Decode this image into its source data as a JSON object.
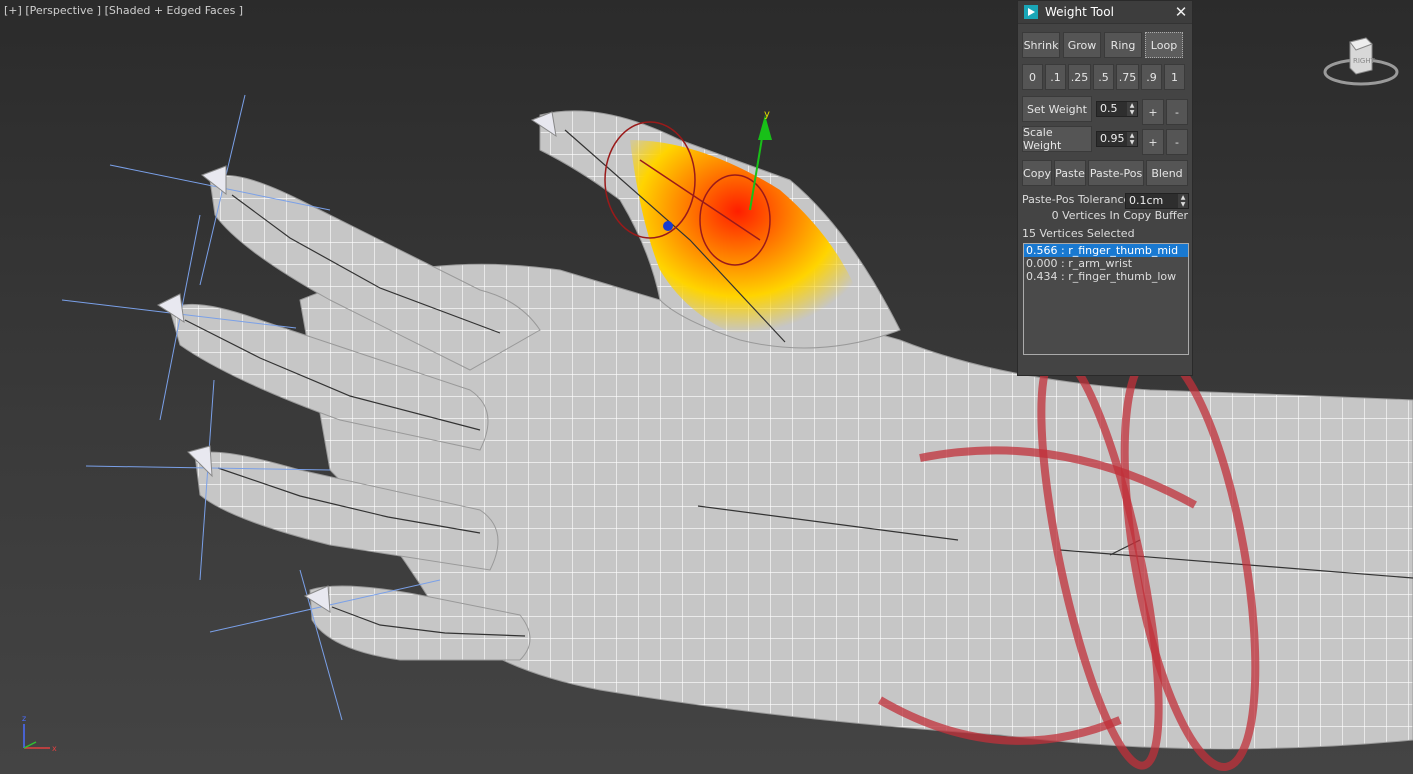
{
  "viewport": {
    "label_parts": [
      "[+]",
      "[Perspective ]",
      "[Shaded + Edged Faces ]"
    ],
    "gizmo_axis_label": "y",
    "viewcube_label": "RIGHT",
    "tripod_labels": {
      "z": "z",
      "x": "x"
    }
  },
  "weight_tool": {
    "title": "Weight Tool",
    "close_glyph": "✕",
    "select_buttons": [
      "Shrink",
      "Grow",
      "Ring",
      "Loop"
    ],
    "preset_weights": [
      "0",
      ".1",
      ".25",
      ".5",
      ".75",
      ".9",
      "1"
    ],
    "set_weight": {
      "label": "Set Weight",
      "value": "0.5",
      "plus": "+",
      "minus": "-"
    },
    "scale_weight": {
      "label": "Scale Weight",
      "value": "0.95",
      "plus": "+",
      "minus": "-"
    },
    "clipboard_buttons": [
      "Copy",
      "Paste",
      "Paste-Pos",
      "Blend"
    ],
    "paste_pos_tolerance": {
      "label": "Paste-Pos Tolerance",
      "value": "0.1cm"
    },
    "copy_buffer_status": "0 Vertices In Copy Buffer",
    "selection_status": "15 Vertices Selected",
    "bone_weights": [
      {
        "text": "0.566 : r_finger_thumb_mid",
        "selected": true
      },
      {
        "text": "0.000 : r_arm_wrist",
        "selected": false
      },
      {
        "text": "0.434 : r_finger_thumb_low",
        "selected": false
      }
    ]
  },
  "colors": {
    "selection_blue": "#1979d1",
    "weight_hot": "#ff2a00",
    "weight_warm": "#ffd400",
    "envelope_red": "#c0303a",
    "bone_link": "#7aa0e8",
    "mesh_fill": "#c9c9c9",
    "mesh_wire": "#ffffff"
  },
  "icons": [
    "app-icon",
    "close-icon",
    "viewcube-icon",
    "axis-tripod-icon",
    "move-gizmo-icon"
  ]
}
